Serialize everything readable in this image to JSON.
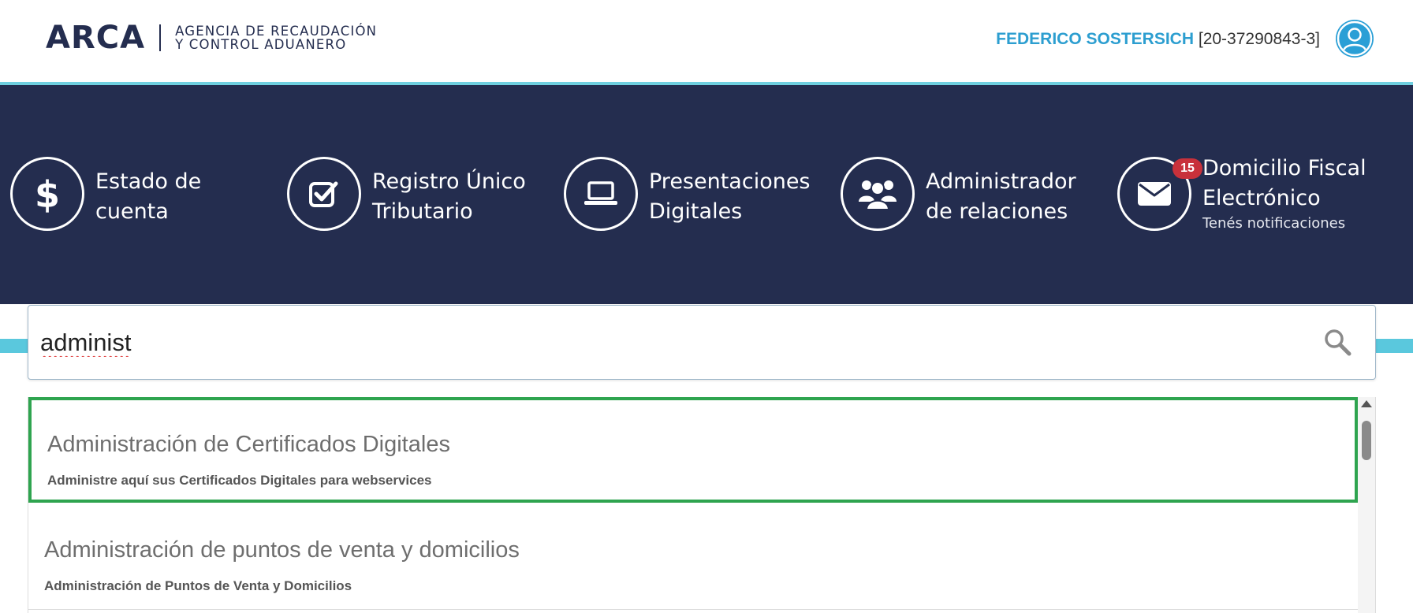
{
  "header": {
    "logo_mark": "ARCA",
    "logo_line1": "AGENCIA DE RECAUDACIÓN",
    "logo_line2": "Y CONTROL ADUANERO",
    "user_name": "FEDERICO SOSTERSICH",
    "user_cuit": "[20-37290843-3]",
    "avatar_icon": "user-circle-icon"
  },
  "tiles": [
    {
      "icon": "dollar-icon",
      "line1": "Estado de",
      "line2": "cuenta"
    },
    {
      "icon": "checkbox-icon",
      "line1": "Registro Único",
      "line2": "Tributario"
    },
    {
      "icon": "laptop-icon",
      "line1": "Presentaciones",
      "line2": "Digitales"
    },
    {
      "icon": "users-icon",
      "line1": "Administrador",
      "line2": "de relaciones"
    },
    {
      "icon": "envelope-icon",
      "line1": "Domicilio Fiscal",
      "line2": "Electrónico",
      "subtext": "Tenés notificaciones",
      "badge": "15"
    }
  ],
  "search": {
    "value": "administ",
    "icon": "search-icon"
  },
  "results": [
    {
      "title": "Administración de Certificados Digitales",
      "description": "Administre aquí sus Certificados Digitales para webservices"
    },
    {
      "title": "Administración de puntos de venta y domicilios",
      "description": "Administración de Puntos de Venta y Domicilios"
    }
  ],
  "colors": {
    "navy": "#242d4f",
    "cyan": "#5ac8dd",
    "user_blue": "#2c9ed0",
    "badge_red": "#c8313b",
    "highlight_green": "#2ea44f"
  }
}
